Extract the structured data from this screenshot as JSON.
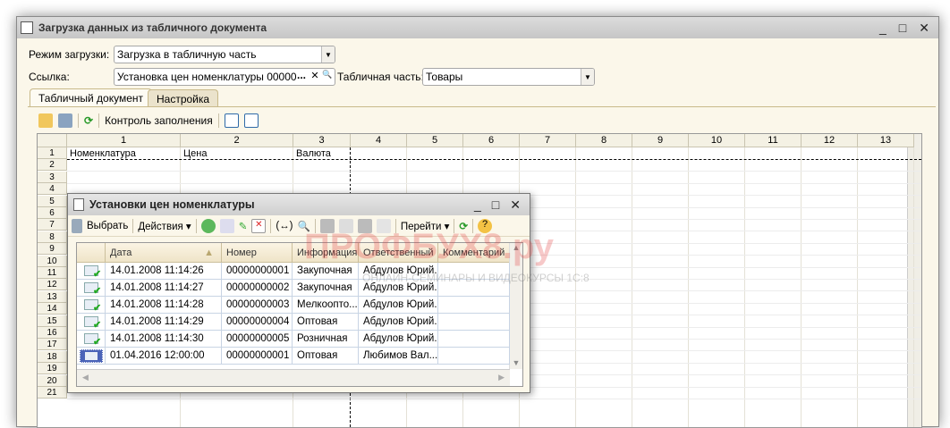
{
  "window": {
    "title": "Загрузка данных из табличного документа",
    "minimize": "_",
    "maximize": "□",
    "close": "✕"
  },
  "form": {
    "mode_label": "Режим загрузки:",
    "mode_value": "Загрузка в табличную часть",
    "link_label": "Ссылка:",
    "link_value": "Установка цен номенклатуры 0000000",
    "link_select": "...",
    "link_clear": "✕",
    "link_open": "🔍",
    "tabpart_label": "Табличная часть:",
    "tabpart_value": "Товары"
  },
  "tabs": [
    {
      "label": "Табличный документ",
      "active": true
    },
    {
      "label": "Настройка",
      "active": false
    }
  ],
  "sheet_toolbar": {
    "check_label": "Контроль заполнения"
  },
  "sheet": {
    "columns": [
      "1",
      "2",
      "3",
      "4",
      "5",
      "6",
      "7",
      "8",
      "9",
      "10",
      "11",
      "12",
      "13"
    ],
    "rows": [
      "1",
      "2",
      "3",
      "4",
      "5",
      "6",
      "7",
      "8",
      "9",
      "10",
      "11",
      "12",
      "13",
      "14",
      "15",
      "16",
      "17",
      "18",
      "19",
      "20",
      "21"
    ],
    "header_cells": [
      "Номенклатура",
      "Цена",
      "Валюта"
    ]
  },
  "popup": {
    "title": "Установки цен номенклатуры",
    "toolbar": {
      "select": "Выбрать",
      "actions": "Действия",
      "goto": "Перейти"
    },
    "columns": [
      "Дата",
      "Номер",
      "Информация",
      "Ответственный",
      "Комментарий"
    ],
    "rows": [
      {
        "date": "14.01.2008 11:14:26",
        "number": "00000000001",
        "info": "Закупочная",
        "resp": "Абдулов Юрий...",
        "comment": "",
        "posted": true
      },
      {
        "date": "14.01.2008 11:14:27",
        "number": "00000000002",
        "info": "Закупочная",
        "resp": "Абдулов Юрий...",
        "comment": "",
        "posted": true
      },
      {
        "date": "14.01.2008 11:14:28",
        "number": "00000000003",
        "info": "Мелкоопто...",
        "resp": "Абдулов Юрий...",
        "comment": "",
        "posted": true
      },
      {
        "date": "14.01.2008 11:14:29",
        "number": "00000000004",
        "info": "Оптовая",
        "resp": "Абдулов Юрий...",
        "comment": "",
        "posted": true
      },
      {
        "date": "14.01.2008 11:14:30",
        "number": "00000000005",
        "info": "Розничная",
        "resp": "Абдулов Юрий...",
        "comment": "",
        "posted": true
      },
      {
        "date": "01.04.2016 12:00:00",
        "number": "00000000001",
        "info": "Оптовая",
        "resp": "Любимов Вал...",
        "comment": "",
        "posted": false,
        "selected": true
      }
    ]
  },
  "watermark": {
    "brand": "ПРОФБУХ8.ру",
    "tagline": "ОНЛАЙН-СЕМИНАРЫ И ВИДЕОКУРСЫ 1С:8"
  }
}
